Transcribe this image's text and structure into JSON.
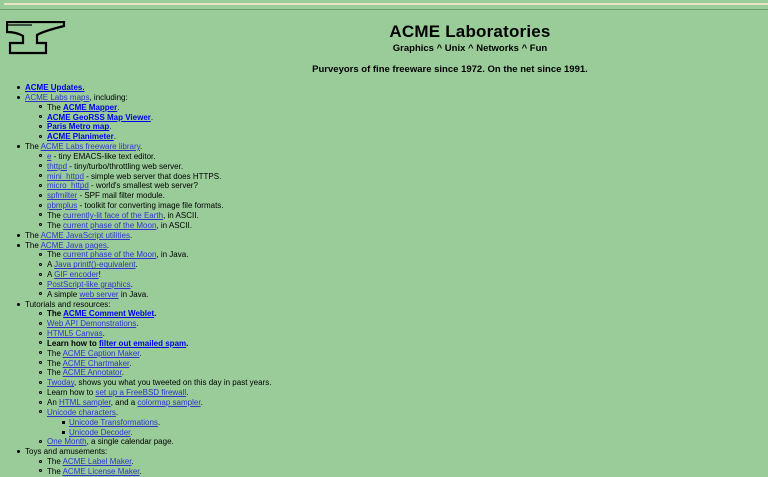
{
  "header": {
    "title": "ACME Laboratories",
    "tagline": "Graphics ^ Unix ^ Networks ^ Fun",
    "purveyors": "Purveyors of fine freeware since 1972. On the net since 1991."
  },
  "items": {
    "updates": "ACME Updates.",
    "labs_maps": "ACME Labs maps",
    "labs_maps_suffix": ", including:",
    "mapper_prefix": "The ",
    "mapper": "ACME Mapper",
    "mapper_suffix": ".",
    "georss": "ACME GeoRSS Map Viewer",
    "georss_suffix": ".",
    "paris": "Paris Metro map",
    "paris_suffix": ".",
    "planimeter": "ACME Planimeter",
    "planimeter_suffix": ".",
    "freeware_prefix": "The ",
    "freeware": "ACME Labs freeware library",
    "freeware_suffix": ".",
    "e": "e",
    "e_desc": " - tiny EMACS-like text editor.",
    "thttpd": "thttpd",
    "thttpd_desc": " - tiny/turbo/throttling web server.",
    "mini_httpd": "mini_httpd",
    "mini_httpd_desc": " - simple web server that does HTTPS.",
    "micro_httpd": "micro_httpd",
    "micro_httpd_desc": " - world's smallest web server?",
    "spfmilter": "spfmilter",
    "spfmilter_desc": " - SPF mail filter module.",
    "pbmplus": "pbmplus",
    "pbmplus_desc": " - toolkit for converting image file formats.",
    "earth_prefix": "The ",
    "earth": "currently-lit face of the Earth",
    "earth_suffix": ", in ASCII.",
    "moon_prefix": "The ",
    "moon": "current phase of the Moon",
    "moon_suffix": ", in ASCII.",
    "js_prefix": "The ",
    "js": "ACME JavaScript utilities",
    "js_suffix": ".",
    "java_prefix": "The ",
    "java": "ACME Java pages",
    "java_suffix": ".",
    "jmoon_prefix": "The ",
    "jmoon": "current phase of the Moon",
    "jmoon_suffix": ", in Java.",
    "printf_prefix": "A ",
    "printf": "Java printf()-equivalent",
    "printf_suffix": ".",
    "gif_prefix": "A ",
    "gif": "GIF encoder",
    "gif_suffix": "!",
    "postscript": "PostScript-like graphics",
    "postscript_suffix": ".",
    "jws_prefix": "A simple ",
    "jws": "web server",
    "jws_suffix": " in Java.",
    "tutorials": "Tutorials and resources:",
    "weblet_prefix": "The ",
    "weblet": "ACME Comment Weblet",
    "weblet_suffix": ".",
    "webapi": "Web API Demonstrations",
    "webapi_suffix": ".",
    "canvas": "HTML5 Canvas",
    "canvas_suffix": ".",
    "spam_prefix": "Learn how to ",
    "spam": "filter out emailed spam",
    "spam_suffix": ".",
    "caption_prefix": "The ",
    "caption": "ACME Caption Maker",
    "caption_suffix": ".",
    "chart_prefix": "The ",
    "chart": "ACME Chartmaker",
    "chart_suffix": ".",
    "annot_prefix": "The ",
    "annot": "ACME Annotator",
    "annot_suffix": ".",
    "twoday": "Twoday",
    "twoday_suffix": ", shows you what you tweeted on this day in past years.",
    "firewall_prefix": "Learn how to ",
    "firewall": "set up a FreeBSD firewall",
    "firewall_suffix": ".",
    "sampler_prefix": "An ",
    "sampler": "HTML sampler",
    "sampler_mid": ", and a ",
    "colormap": "colormap sampler",
    "colormap_suffix": ".",
    "unicode": "Unicode characters",
    "unicode_suffix": ".",
    "utrans": "Unicode Transformations",
    "utrans_suffix": ".",
    "udecoder": "Unicode Decoder",
    "udecoder_suffix": ".",
    "onemonth": "One Month",
    "onemonth_suffix": ", a single calendar page.",
    "toys": "Toys and amusements:",
    "label_prefix": "The ",
    "label": "ACME Label Maker",
    "label_suffix": ".",
    "license_prefix": "The ",
    "license": "ACME License Maker",
    "license_suffix": "."
  }
}
